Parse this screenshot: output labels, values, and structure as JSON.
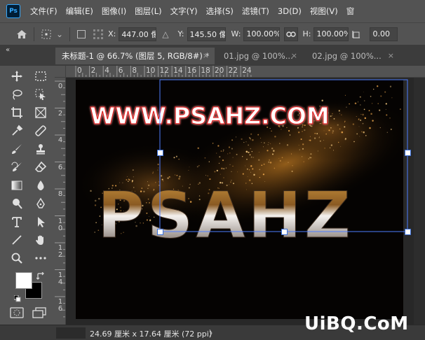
{
  "app": {
    "logo_text": "Ps",
    "accent": "#31a8ff"
  },
  "menu": [
    "文件(F)",
    "编辑(E)",
    "图像(I)",
    "图层(L)",
    "文字(Y)",
    "选择(S)",
    "滤镜(T)",
    "3D(D)",
    "视图(V)",
    "窗"
  ],
  "options": {
    "x_label": "X:",
    "x_value": "447.00 像",
    "y_label": "Y:",
    "y_value": "145.50 像",
    "w_label": "W:",
    "w_value": "100.00%",
    "h_label": "H:",
    "h_value": "100.00%",
    "angle_value": "0.00"
  },
  "panel_collapse": "«",
  "tabs": [
    {
      "label": "未标题-1 @ 66.7% (图层 5, RGB/8#) *",
      "close": "×",
      "active": true
    },
    {
      "label": "01.jpg @ 100%...",
      "close": "×",
      "active": false
    },
    {
      "label": "02.jpg @ 100%...",
      "close": "×",
      "active": false
    }
  ],
  "ruler_h": [
    "0",
    "2",
    "4",
    "6",
    "8",
    "10",
    "12",
    "14",
    "16",
    "18",
    "20",
    "22",
    "24"
  ],
  "ruler_v": [
    "0",
    "2",
    "4",
    "6",
    "8",
    "1\n0",
    "1\n2",
    "1\n4",
    "1\n6"
  ],
  "canvas_art": {
    "url_text": "WWW.PSAHZ.COM",
    "big_text": "PSAHZ"
  },
  "toolbar_icons": [
    "move-icon",
    "marquee-icon",
    "lasso-icon",
    "quick-select-icon",
    "crop-icon",
    "frame-icon",
    "eyedropper-icon",
    "healing-icon",
    "brush-icon",
    "stamp-icon",
    "history-brush-icon",
    "eraser-icon",
    "gradient-icon",
    "blur-icon",
    "dodge-icon",
    "pen-icon",
    "type-icon",
    "path-select-icon",
    "line-icon",
    "hand-icon",
    "zoom-icon",
    "more-icon"
  ],
  "swatches": {
    "foreground": "#ffffff",
    "background": "#000000"
  },
  "status": {
    "doc_size": "24.69 厘米 x 17.64 厘米 (72 ppi)",
    "arrow": "〉"
  },
  "watermark": "UiBQ.CoM"
}
